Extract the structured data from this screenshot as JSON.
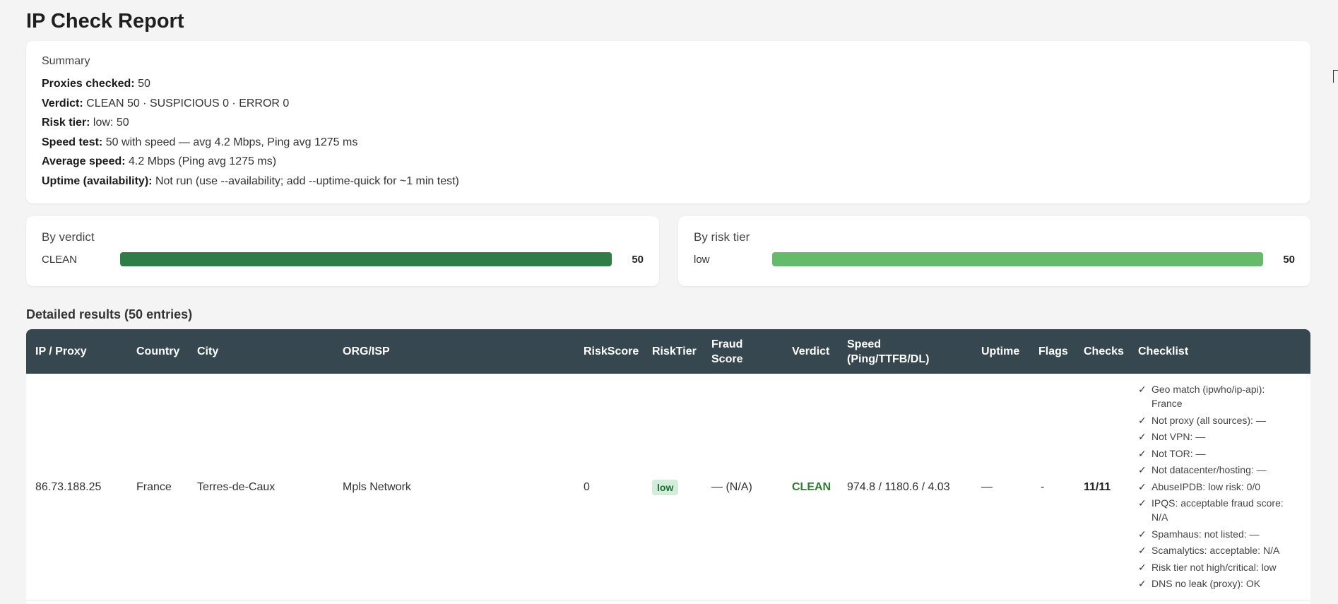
{
  "page": {
    "title": "IP Check Report"
  },
  "summary": {
    "heading": "Summary",
    "lines": [
      {
        "label": "Proxies checked:",
        "value": "50"
      },
      {
        "label": "Verdict:",
        "value": "CLEAN 50 · SUSPICIOUS 0 · ERROR 0"
      },
      {
        "label": "Risk tier:",
        "value": "low: 50"
      },
      {
        "label": "Speed test:",
        "value": "50 with speed — avg 4.2 Mbps, Ping avg 1275 ms"
      },
      {
        "label": "Average speed:",
        "value": "4.2 Mbps (Ping avg 1275 ms)"
      },
      {
        "label": "Uptime (availability):",
        "value": "Not run (use --availability; add --uptime-quick for ~1 min test)"
      }
    ]
  },
  "by_verdict": {
    "title": "By verdict",
    "rows": [
      {
        "label": "CLEAN",
        "count": "50",
        "fraction": 1.0
      }
    ],
    "colors": {
      "fill": "#2e7d46"
    }
  },
  "by_risk_tier": {
    "title": "By risk tier",
    "rows": [
      {
        "label": "low",
        "count": "50",
        "fraction": 1.0
      }
    ],
    "colors": {
      "fill": "#66bb6a"
    }
  },
  "details": {
    "heading": "Detailed results (50 entries)",
    "columns": {
      "ip": "IP / Proxy",
      "country": "Country",
      "city": "City",
      "org": "ORG/ISP",
      "risk_score": "RiskScore",
      "risk_tier": "RiskTier",
      "fraud_score": "Fraud Score",
      "verdict": "Verdict",
      "speed": "Speed (Ping/TTFB/DL)",
      "uptime": "Uptime",
      "flags": "Flags",
      "checks": "Checks",
      "checklist": "Checklist"
    },
    "rows": [
      {
        "ip": "86.73.188.25",
        "country": "France",
        "city": "Terres-de-Caux",
        "org": "Mpls Network",
        "risk_score": "0",
        "risk_tier": "low",
        "fraud_score": "— (N/A)",
        "verdict": "CLEAN",
        "speed": "974.8 / 1180.6 / 4.03",
        "uptime": "—",
        "flags": "-",
        "checks": "11/11",
        "checklist": [
          "Geo match (ipwho/ip-api): France",
          "Not proxy (all sources): —",
          "Not VPN: —",
          "Not TOR: —",
          "Not datacenter/hosting: —",
          "AbuseIPDB: low risk: 0/0",
          "IPQS: acceptable fraud score: N/A",
          "Spamhaus: not listed: —",
          "Scamalytics: acceptable: N/A",
          "Risk tier not high/critical: low",
          "DNS no leak (proxy): OK"
        ]
      }
    ]
  },
  "icons": {
    "check": "check-mark-icon",
    "cursor": "mouse-cursor-icon"
  },
  "colors": {
    "header_bg": "#37474f",
    "clean": "#2e7d32",
    "badge_bg": "#d4edda"
  }
}
